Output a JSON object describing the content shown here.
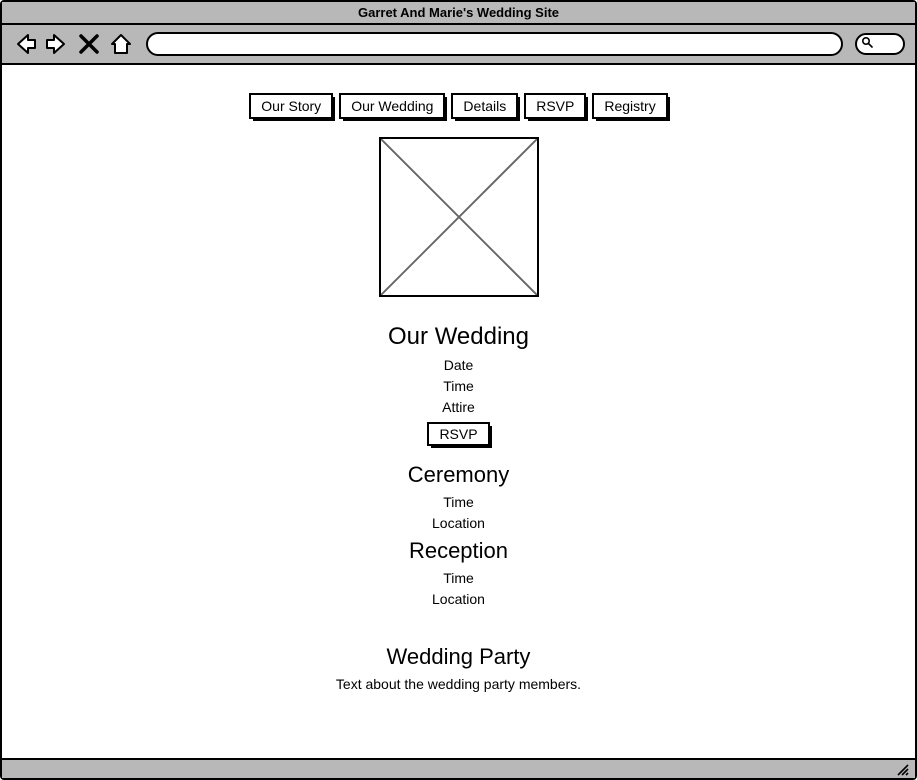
{
  "window": {
    "title": "Garret And Marie's Wedding Site"
  },
  "nav": {
    "items": [
      "Our Story",
      "Our Wedding",
      "Details",
      "RSVP",
      "Registry"
    ]
  },
  "sections": {
    "wedding": {
      "heading": "Our Wedding",
      "lines": [
        "Date",
        "Time",
        "Attire"
      ],
      "rsvp_label": "RSVP"
    },
    "ceremony": {
      "heading": "Ceremony",
      "lines": [
        "Time",
        "Location"
      ]
    },
    "reception": {
      "heading": "Reception",
      "lines": [
        "Time",
        "Location"
      ]
    },
    "party": {
      "heading": "Wedding Party",
      "text": "Text about the wedding party members."
    }
  }
}
